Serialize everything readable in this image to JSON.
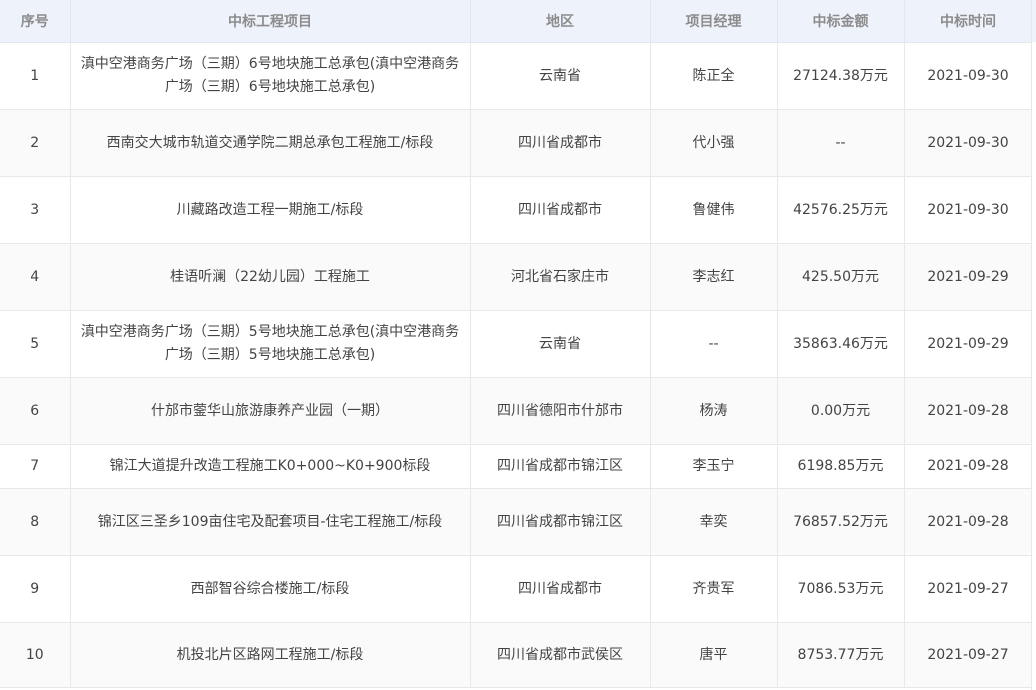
{
  "headers": {
    "no": "序号",
    "project": "中标工程项目",
    "region": "地区",
    "manager": "项目经理",
    "amount": "中标金额",
    "date": "中标时间"
  },
  "rows": [
    {
      "no": "1",
      "project": "滇中空港商务广场（三期）6号地块施工总承包(滇中空港商务广场（三期）6号地块施工总承包)",
      "region": "云南省",
      "manager": "陈正全",
      "amount": "27124.38万元",
      "date": "2021-09-30"
    },
    {
      "no": "2",
      "project": "西南交大城市轨道交通学院二期总承包工程施工/标段",
      "region": "四川省成都市",
      "manager": "代小强",
      "amount": "--",
      "date": "2021-09-30"
    },
    {
      "no": "3",
      "project": "川藏路改造工程一期施工/标段",
      "region": "四川省成都市",
      "manager": "鲁健伟",
      "amount": "42576.25万元",
      "date": "2021-09-30"
    },
    {
      "no": "4",
      "project": "桂语听澜（22幼儿园）工程施工",
      "region": "河北省石家庄市",
      "manager": "李志红",
      "amount": "425.50万元",
      "date": "2021-09-29"
    },
    {
      "no": "5",
      "project": "滇中空港商务广场（三期）5号地块施工总承包(滇中空港商务广场（三期）5号地块施工总承包)",
      "region": "云南省",
      "manager": "--",
      "amount": "35863.46万元",
      "date": "2021-09-29"
    },
    {
      "no": "6",
      "project": "什邡市蓥华山旅游康养产业园（一期）",
      "region": "四川省德阳市什邡市",
      "manager": "杨涛",
      "amount": "0.00万元",
      "date": "2021-09-28"
    },
    {
      "no": "7",
      "project": "锦江大道提升改造工程施工K0+000~K0+900标段",
      "region": "四川省成都市锦江区",
      "manager": "李玉宁",
      "amount": "6198.85万元",
      "date": "2021-09-28"
    },
    {
      "no": "8",
      "project": "锦江区三圣乡109亩住宅及配套项目-住宅工程施工/标段",
      "region": "四川省成都市锦江区",
      "manager": "幸奕",
      "amount": "76857.52万元",
      "date": "2021-09-28"
    },
    {
      "no": "9",
      "project": "西部智谷综合楼施工/标段",
      "region": "四川省成都市",
      "manager": "齐贵军",
      "amount": "7086.53万元",
      "date": "2021-09-27"
    },
    {
      "no": "10",
      "project": "机投北片区路网工程施工/标段",
      "region": "四川省成都市武侯区",
      "manager": "唐平",
      "amount": "8753.77万元",
      "date": "2021-09-27"
    }
  ]
}
